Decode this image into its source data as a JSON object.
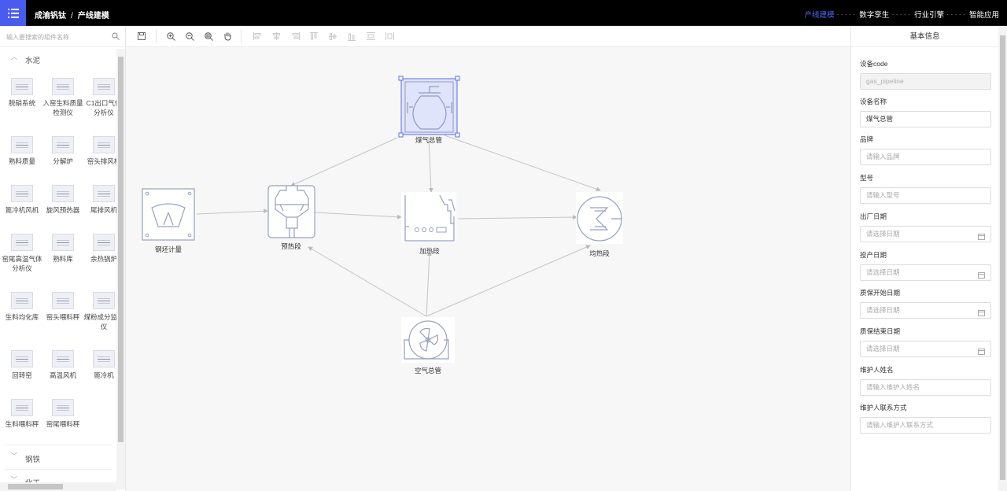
{
  "header": {
    "app_name": "成渝钒钛",
    "page_name": "产线建模",
    "nav": [
      "产线建模",
      "数字孪生",
      "行业引擎",
      "智能应用"
    ],
    "accent": "#4a5cf0"
  },
  "sidebar": {
    "search_placeholder": "输入要搜索的组件名称",
    "groups": [
      {
        "label": "水泥",
        "expanded": true,
        "items": [
          "脱硝系统",
          "入窑生料质量检测仪",
          "C1出口气体分析仪",
          "熟料质量",
          "分解炉",
          "窑头排风机",
          "篦冷机风机",
          "旋风预热器",
          "尾排风机",
          "窑尾高温气体分析仪",
          "熟料库",
          "余热锅炉",
          "生料均化库",
          "窑头喂料秤",
          "煤粉成分监测仪",
          "回转窑",
          "高温风机",
          "篦冷机",
          "生料喂料秤",
          "窑尾喂料秤"
        ]
      },
      {
        "label": "钢铁",
        "expanded": false
      },
      {
        "label": "化工",
        "expanded": false
      }
    ]
  },
  "toolbar": {
    "icons": [
      "save-icon",
      "zoom-in-icon",
      "zoom-out-icon",
      "zoom-fit-icon",
      "pan-hand-icon",
      "align-left-icon",
      "align-center-icon",
      "align-right-icon",
      "align-top-icon",
      "align-middle-icon",
      "align-bottom-icon",
      "distribute-h-icon",
      "distribute-v-icon"
    ]
  },
  "canvas": {
    "nodes": [
      {
        "id": "gas",
        "label": "煤气总管",
        "selected": true
      },
      {
        "id": "meter",
        "label": "钢坯计量"
      },
      {
        "id": "preheat",
        "label": "预热段"
      },
      {
        "id": "heat",
        "label": "加热段"
      },
      {
        "id": "soak",
        "label": "均热段"
      },
      {
        "id": "air",
        "label": "空气总管"
      }
    ],
    "edges": [
      [
        "gas",
        "preheat"
      ],
      [
        "gas",
        "heat"
      ],
      [
        "gas",
        "soak"
      ],
      [
        "meter",
        "preheat"
      ],
      [
        "preheat",
        "heat"
      ],
      [
        "heat",
        "soak"
      ],
      [
        "air",
        "preheat"
      ],
      [
        "air",
        "heat"
      ],
      [
        "air",
        "soak"
      ]
    ]
  },
  "properties": {
    "title": "基本信息",
    "fields": [
      {
        "label": "设备code",
        "value": "gas_pipeline",
        "disabled": true
      },
      {
        "label": "设备名称",
        "value": "煤气总管"
      },
      {
        "label": "品牌",
        "placeholder": "请输入品牌"
      },
      {
        "label": "型号",
        "placeholder": "请输入型号"
      },
      {
        "label": "出厂日期",
        "placeholder": "请选择日期",
        "date": true
      },
      {
        "label": "投产日期",
        "placeholder": "请选择日期",
        "date": true
      },
      {
        "label": "质保开始日期",
        "placeholder": "请选择日期",
        "date": true
      },
      {
        "label": "质保结束日期",
        "placeholder": "请选择日期",
        "date": true
      },
      {
        "label": "维护人姓名",
        "placeholder": "请输入维护人姓名"
      },
      {
        "label": "维护人联系方式",
        "placeholder": "请输入维护人联系方式"
      }
    ]
  }
}
